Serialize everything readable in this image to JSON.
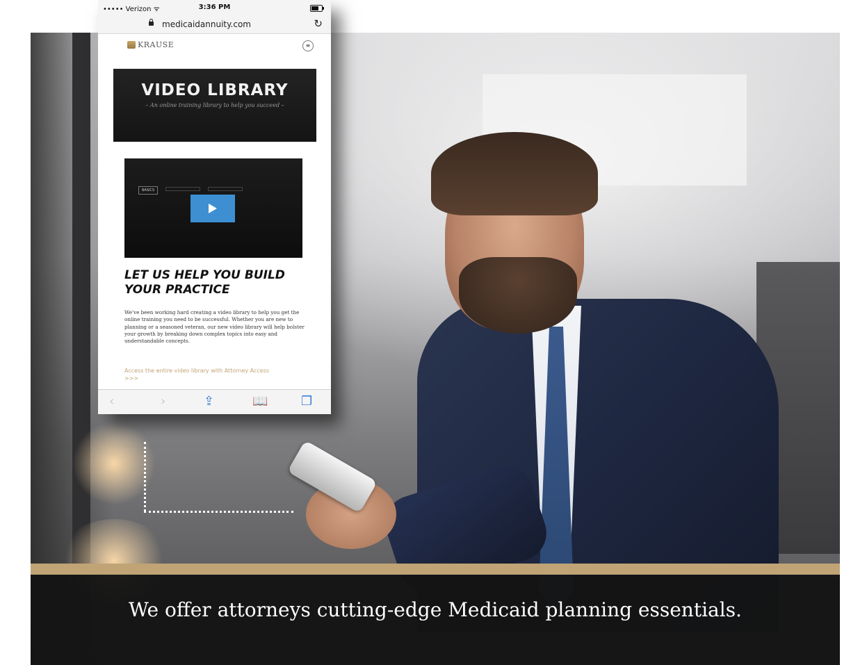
{
  "phone": {
    "status": {
      "carrier": "••••• Verizon ᯤ",
      "time": "3:36 PM"
    },
    "browser": {
      "url": "medicaidannuity.com",
      "reload_icon": "↻"
    },
    "site": {
      "logo_text": "KRAUSE",
      "menu_icon": "≡"
    },
    "hero": {
      "title": "VIDEO LIBRARY",
      "subtitle": "– An online training library to help you succeed –"
    },
    "video": {
      "tabs": [
        "BASICS",
        "",
        ""
      ]
    },
    "content": {
      "heading": "LET US HELP YOU BUILD YOUR PRACTICE",
      "body": "We've been working hard creating a video library to help you get the online training you need to be successful. Whether you are new to planning or a seasoned veteran, our new video library will help bolster your growth by breaking down complex topics into easy and understandable concepts.",
      "link": "Access the entire video library with Attorney Access >>>"
    },
    "toolbar": {
      "back": "‹",
      "forward": "›",
      "share": "⇪",
      "bookmarks": "📖",
      "tabs": "❐"
    }
  },
  "banner": {
    "tagline": "We offer attorneys cutting-edge Medicaid planning essentials.",
    "accent_color": "#c0a476"
  }
}
